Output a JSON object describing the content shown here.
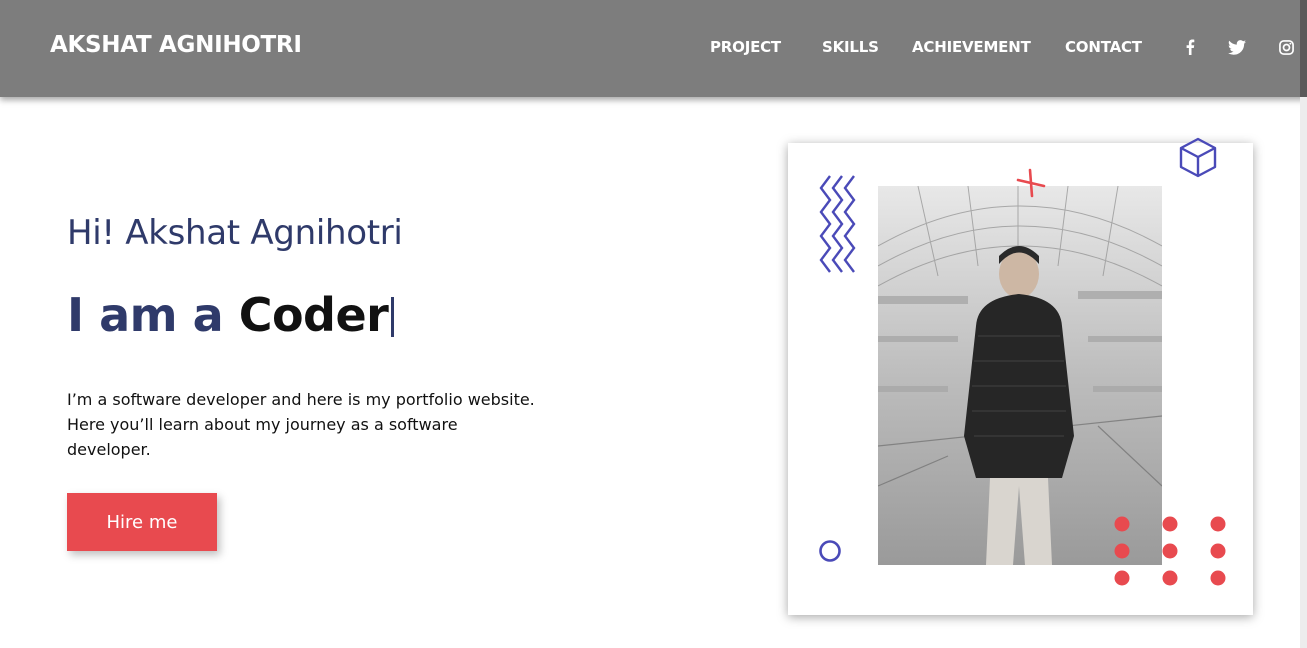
{
  "header": {
    "brand": "AKSHAT AGNIHOTRI",
    "nav": [
      "PROJECT",
      "SKILLS",
      "ACHIEVEMENT",
      "CONTACT"
    ],
    "social": [
      "facebook-icon",
      "twitter-icon",
      "instagram-icon"
    ]
  },
  "hero": {
    "greeting": "Hi! Akshat Agnihotri",
    "headline_prefix": "I am a ",
    "headline_role": "Coder",
    "description": "I’m a software developer and here is my portfolio website. Here you’ll learn about my journey as a software developer.",
    "cta_label": "Hire me"
  },
  "card": {
    "photo_icon": "portrait-photo",
    "decorations": [
      "zigzag-lines",
      "cross-mark",
      "cube-outline",
      "ring",
      "dot-grid"
    ]
  },
  "colors": {
    "header_bg": "#7d7d7d",
    "accent_red": "#e84a4f",
    "accent_blue": "#4a4ab8",
    "heading_navy": "#2f3a6a"
  }
}
